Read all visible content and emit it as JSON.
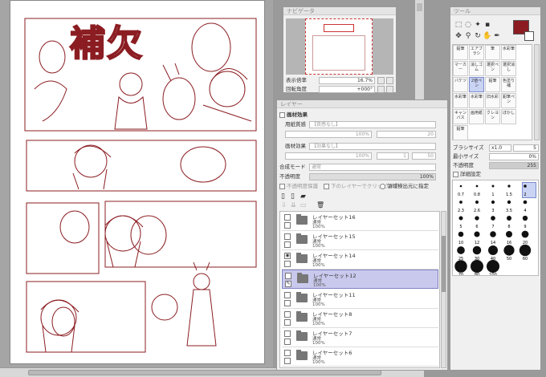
{
  "navigator": {
    "title": "ナビゲータ",
    "zoom_label": "表示倍率",
    "zoom_value": "16.7%",
    "rotation_label": "回転角度",
    "rotation_value": "+000°"
  },
  "canvas": {
    "title_text": "補欠"
  },
  "layer_panel": {
    "title": "レイヤー",
    "paper_effect_label": "画材効果",
    "paper_texture_label": "用紙質感",
    "paper_texture_value": "【質感なし】",
    "paper_texture_scale": "100%",
    "paper_texture_strength": "20",
    "texture_effect_label": "画材効果",
    "texture_effect_value": "【効果なし】",
    "texture_effect_scale": "100%",
    "texture_effect_strength": "1",
    "texture_effect_value2": "50",
    "blend_mode_label": "合成モード",
    "blend_mode_value": "通常",
    "opacity_label": "不透明度",
    "opacity_value": "100%",
    "protect_label": "不透明度保護",
    "clip_label": "下のレイヤーでクリッピング",
    "source_label": "領域検出元に指定",
    "layers": [
      {
        "name": "レイヤーセット16",
        "mode": "通常",
        "opacity": "100%"
      },
      {
        "name": "レイヤーセット15",
        "mode": "通常",
        "opacity": "100%"
      },
      {
        "name": "レイヤーセット14",
        "mode": "通常",
        "opacity": "100%"
      },
      {
        "name": "レイヤーセット12",
        "mode": "通常",
        "opacity": "100%"
      },
      {
        "name": "レイヤーセット11",
        "mode": "通常",
        "opacity": "100%"
      },
      {
        "name": "レイヤーセット8",
        "mode": "通常",
        "opacity": "100%"
      },
      {
        "name": "レイヤーセット7",
        "mode": "通常",
        "opacity": "100%"
      },
      {
        "name": "レイヤーセット6",
        "mode": "通常",
        "opacity": "100%"
      }
    ]
  },
  "tool_panel": {
    "title": "ツール",
    "primary_color": "#8b1d22",
    "brushes": [
      [
        "鉛筆",
        "エアブラシ",
        "筆",
        "水彩筆"
      ],
      [
        "マーカー",
        "消しゴム",
        "選択ペン",
        "選択消し"
      ],
      [
        "バケツ",
        "2値ペン",
        "鉛筆",
        "色塗り補"
      ],
      [
        "水彩筆",
        "水彩筆",
        "旧水彩",
        "鉛筆ペン"
      ],
      [
        "キャンバス",
        "画用紙",
        "クレヨン",
        "ぼかし"
      ],
      [
        "鉛筆",
        "",
        "",
        ""
      ]
    ],
    "brush_size_label": "ブラシサイズ",
    "brush_size_mult": "x1.0",
    "brush_size_value": "5",
    "min_size_label": "最小サイズ",
    "min_size_value": "0%",
    "opacity_label": "不透明度",
    "opacity_value": "255",
    "detail_label": "詳細設定",
    "sizes": [
      "0.7",
      "0.8",
      "1",
      "1.5",
      "2",
      "2.3",
      "2.6",
      "3",
      "3.5",
      "4",
      "5",
      "6",
      "7",
      "8",
      "9",
      "10",
      "12",
      "14",
      "16",
      "20",
      "25",
      "30",
      "40",
      "50",
      "60",
      "70",
      "80",
      "100"
    ]
  },
  "colors": {
    "accent": "#8b1d22",
    "selected_row": "#c9c9ee",
    "panel_bg": "#f0f0f0"
  }
}
